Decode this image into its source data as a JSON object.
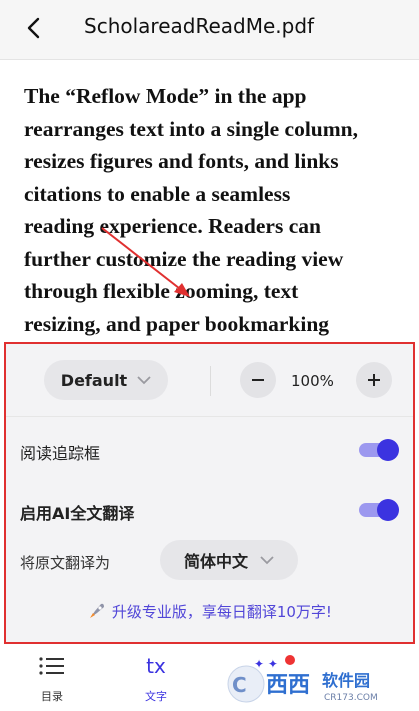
{
  "header": {
    "title": "ScholareadReadMe.pdf"
  },
  "document": {
    "lines": [
      "The “Reflow Mode” in the app",
      "rearranges text into a single column,",
      "resizes figures and fonts, and links",
      "citations to enable a seamless",
      "reading experience. Readers can",
      "further customize the reading view",
      "through flexible zooming, text",
      "resizing, and paper bookmarking"
    ]
  },
  "panel": {
    "mode_label": "Default",
    "zoom_value": "100%",
    "reading_tracker_label": "阅读追踪框",
    "reading_tracker_on": true,
    "ai_translate_label": "启用AI全文翻译",
    "ai_translate_on": true,
    "translate_to_label": "将原文翻译为",
    "translate_to_value": "简体中文",
    "upgrade_text": "升级专业版，享每日翻译10万字!"
  },
  "bottom_nav": {
    "items": [
      {
        "label": "目录",
        "icon": "list-icon"
      },
      {
        "label": "文字",
        "icon": "text-tx-icon"
      }
    ]
  },
  "watermark": {
    "text": "西西软件园",
    "url": "CR173.COM"
  },
  "colors": {
    "accent": "#3b33e0",
    "highlight_border": "#e03030",
    "upgrade_text": "#5146d8"
  }
}
